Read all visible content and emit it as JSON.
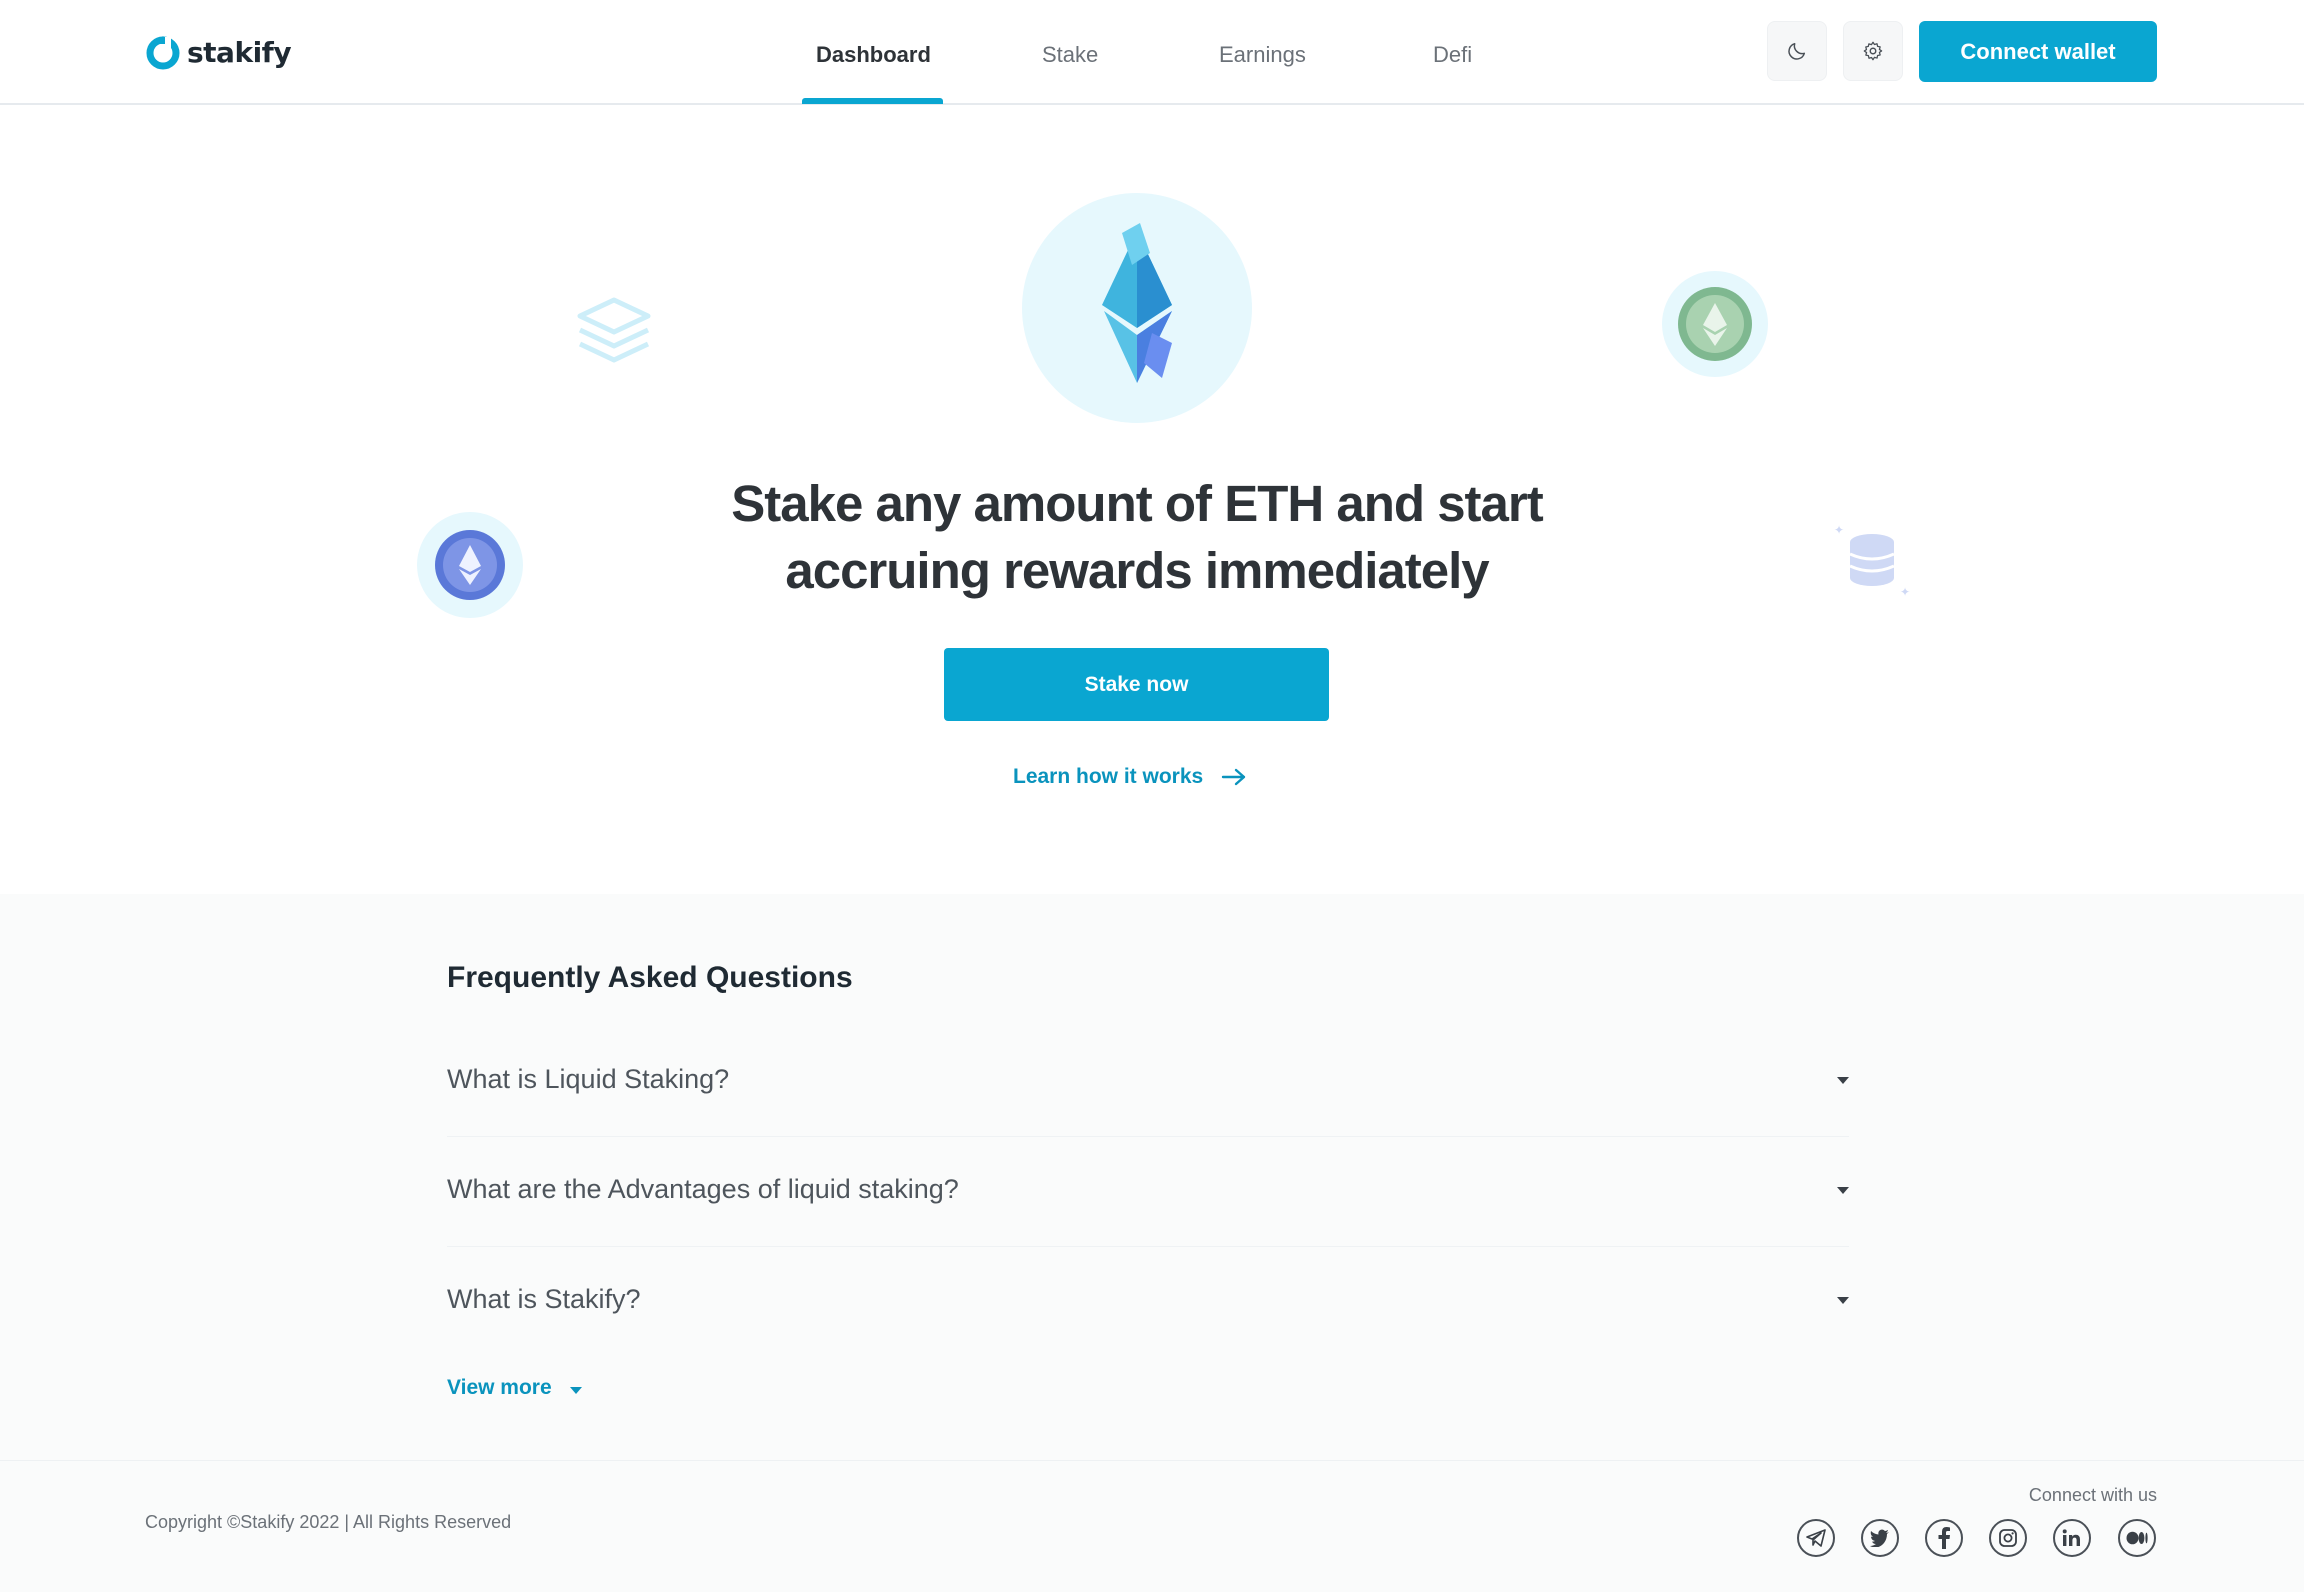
{
  "brand": {
    "name": "stakify",
    "accent": "#0aa6d1"
  },
  "nav": {
    "items": [
      {
        "label": "Dashboard",
        "active": true
      },
      {
        "label": "Stake",
        "active": false
      },
      {
        "label": "Earnings",
        "active": false
      },
      {
        "label": "Defi",
        "active": false
      }
    ],
    "theme_icon": "moon-icon",
    "settings_icon": "gear-icon",
    "connect_label": "Connect wallet"
  },
  "hero": {
    "title_line1": "Stake any amount of ETH and start",
    "title_line2": "accruing rewards immediately",
    "stake_label": "Stake now",
    "learn_label": "Learn how it works"
  },
  "faq": {
    "title": "Frequently Asked Questions",
    "items": [
      {
        "question": "What is Liquid Staking?"
      },
      {
        "question": "What are the Advantages of liquid staking?"
      },
      {
        "question": "What is Stakify?"
      }
    ],
    "view_more_label": "View more"
  },
  "footer": {
    "copyright": "Copyright ©Stakify 2022 | All Rights Reserved",
    "connect_label": "Connect with us",
    "socials": [
      "telegram-icon",
      "twitter-icon",
      "facebook-icon",
      "instagram-icon",
      "linkedin-icon",
      "medium-icon"
    ]
  }
}
